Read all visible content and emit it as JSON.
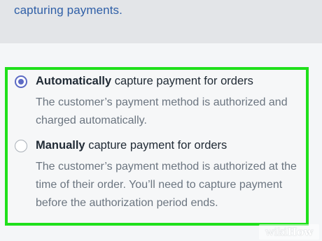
{
  "header": {
    "text": "capturing payments."
  },
  "payment_capture": {
    "options": [
      {
        "selected": true,
        "label_bold": "Automatically",
        "label_rest": " capture payment for orders",
        "description": "The customer’s payment method is authorized and charged automatically."
      },
      {
        "selected": false,
        "label_bold": "Manually",
        "label_rest": " capture payment for orders",
        "description": "The customer’s payment method is authorized at the time of their order. You’ll need to capture payment before the authorization period ends."
      }
    ]
  },
  "watermark": {
    "part1": "wiki",
    "part2": "How"
  },
  "colors": {
    "highlight_border": "#1fe01b",
    "radio_selected": "#5c6ac4",
    "link": "#2f5fa7"
  }
}
